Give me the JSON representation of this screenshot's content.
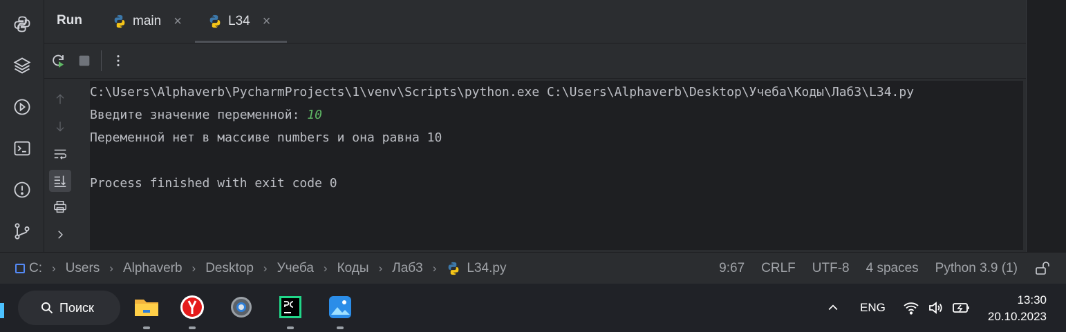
{
  "run_panel": {
    "title": "Run",
    "tabs": [
      {
        "label": "main",
        "close": "×"
      },
      {
        "label": "L34",
        "close": "×"
      }
    ]
  },
  "console": {
    "lines": [
      {
        "text": "C:\\Users\\Alphaverb\\PycharmProjects\\1\\venv\\Scripts\\python.exe C:\\Users\\Alphaverb\\Desktop\\Учеба\\Коды\\Лаб3\\L34.py"
      },
      {
        "text": "Введите значение переменной: ",
        "input": "10"
      },
      {
        "text": "Переменной нет в массиве numbers и она равна 10"
      },
      {
        "text": ""
      },
      {
        "text": "Process finished with exit code 0"
      }
    ]
  },
  "status_bar": {
    "breadcrumbs": [
      "C:",
      "Users",
      "Alphaverb",
      "Desktop",
      "Учеба",
      "Коды",
      "Лаб3",
      "L34.py"
    ],
    "position": "9:67",
    "line_separator": "CRLF",
    "encoding": "UTF-8",
    "indent": "4 spaces",
    "interpreter": "Python 3.9 (1)"
  },
  "taskbar": {
    "search_label": "Поиск",
    "language": "ENG",
    "time": "13:30",
    "date": "20.10.2023"
  },
  "colors": {
    "background": "#1e1f22",
    "panel": "#2b2d30",
    "console_text": "#bcbec4",
    "input_text": "#5fb865",
    "accent": "#548af7"
  }
}
